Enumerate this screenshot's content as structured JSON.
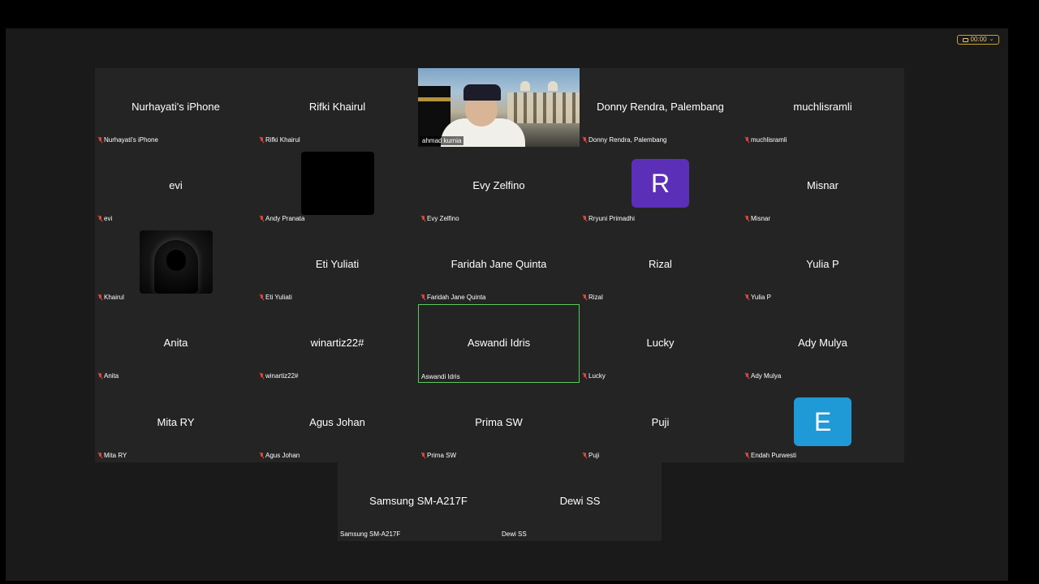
{
  "timer": {
    "time": "00:00",
    "chevron": "⌄",
    "color": "#e9c46a"
  },
  "video_tile": {
    "name": "ahmad kurnia"
  },
  "active_speaker": {
    "name": "Aswandi Idris",
    "label": "Aswandi Idris",
    "border_color": "#5ac85a"
  },
  "participants": [
    {
      "display": "Nurhayati's iPhone",
      "label": "Nurhayati's iPhone"
    },
    {
      "display": "Rifki Khairul",
      "label": "Rifki Khairul"
    },
    {
      "display": "Donny Rendra, Palembang",
      "label": "Donny Rendra, Palembang"
    },
    {
      "display": "muchlisramli",
      "label": "muchlisramli"
    },
    {
      "display": "evi",
      "label": "evi"
    },
    {
      "display": "",
      "label": "Andy Pranata"
    },
    {
      "display": "Evy Zelfino",
      "label": "Evy Zelfino"
    },
    {
      "display": "R",
      "label": "Rryuni Primadhi",
      "avatar_color": "#5b2fb8"
    },
    {
      "display": "Misnar",
      "label": "Misnar"
    },
    {
      "display": "",
      "label": "Khairul"
    },
    {
      "display": "Eti Yuliati",
      "label": "Eti Yuliati"
    },
    {
      "display": "Faridah Jane Quinta",
      "label": "Faridah Jane Quinta"
    },
    {
      "display": "Rizal",
      "label": "Rizal"
    },
    {
      "display": "Yulia P",
      "label": "Yulia P"
    },
    {
      "display": "Anita",
      "label": "Anita"
    },
    {
      "display": "winartiz22#",
      "label": "winartiz22#"
    },
    {
      "display": "Lucky",
      "label": "Lucky"
    },
    {
      "display": "Ady Mulya",
      "label": "Ady Mulya"
    },
    {
      "display": "Mita RY",
      "label": "Mita RY"
    },
    {
      "display": "Agus Johan",
      "label": "Agus Johan"
    },
    {
      "display": "Prima SW",
      "label": "Prima SW"
    },
    {
      "display": "Puji",
      "label": "Puji"
    },
    {
      "display": "E",
      "label": "Endah Purwesti",
      "avatar_color": "#1f9ad6"
    },
    {
      "display": "Samsung SM-A217F",
      "label": "Samsung SM-A217F"
    },
    {
      "display": "Dewi SS",
      "label": "Dewi SS"
    }
  ]
}
